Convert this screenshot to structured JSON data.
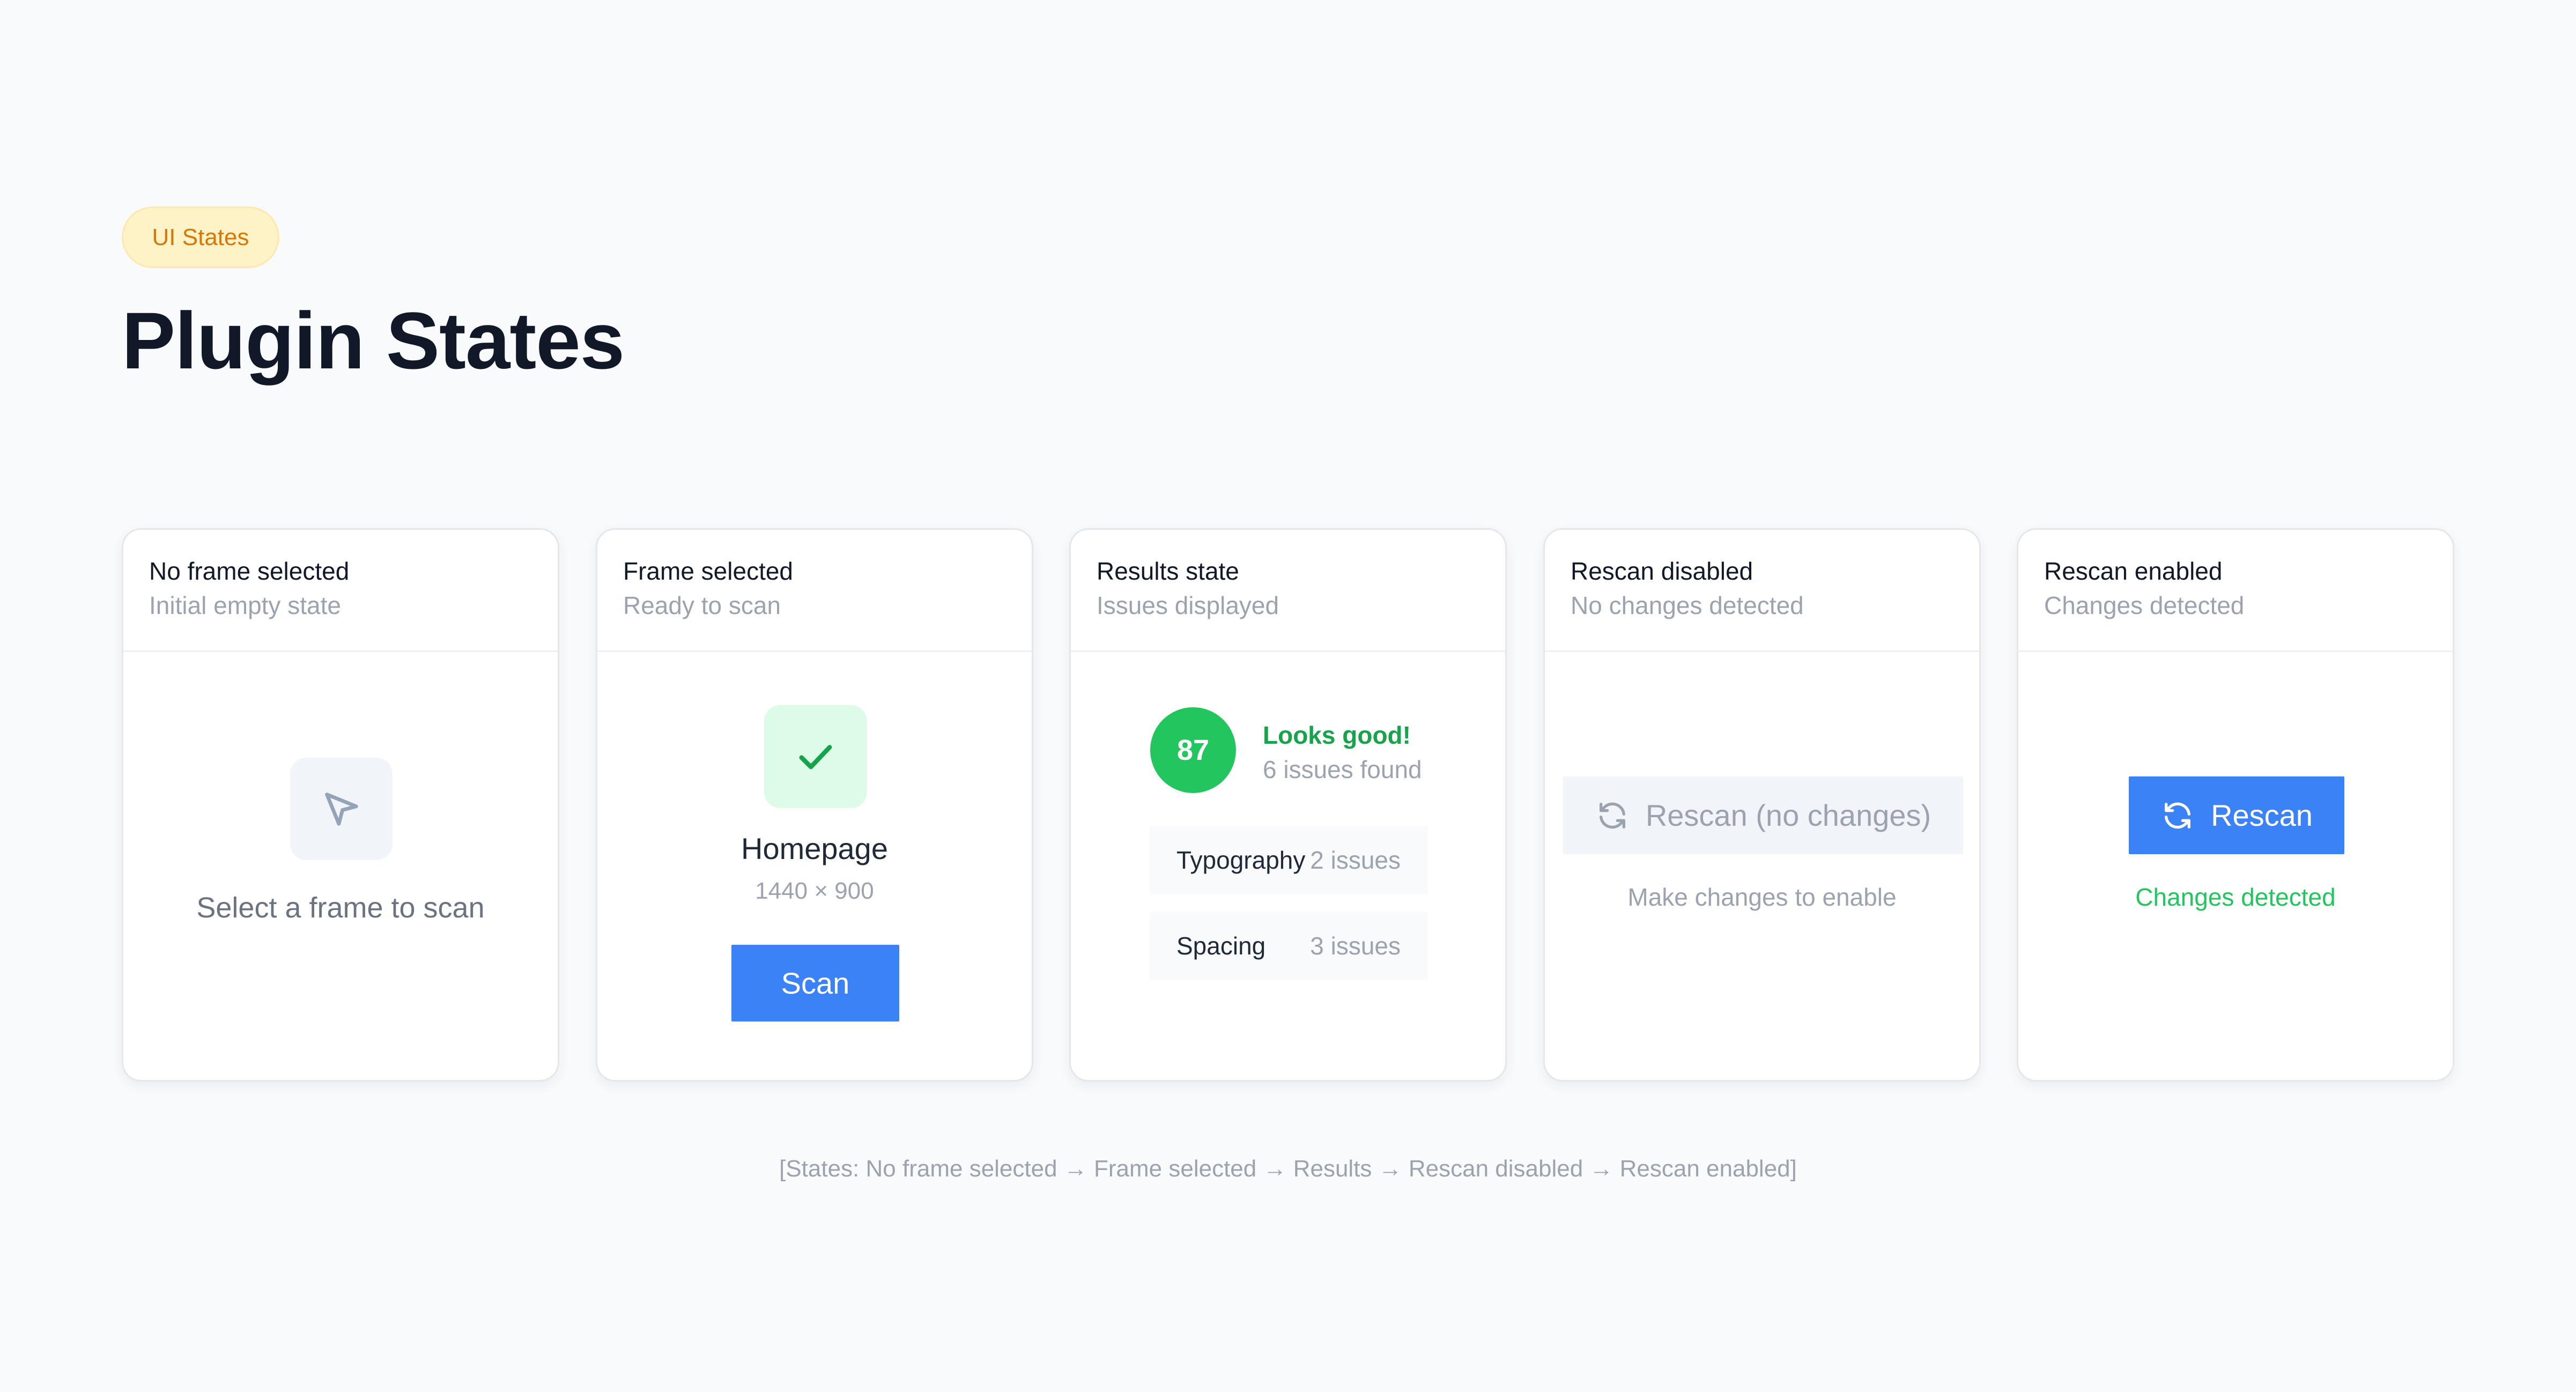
{
  "header": {
    "badge": "UI States",
    "title": "Plugin States"
  },
  "cards": [
    {
      "title": "No frame selected",
      "subtitle": "Initial empty state",
      "icon": "cursor-pointer-icon",
      "message": "Select a frame to scan"
    },
    {
      "title": "Frame selected",
      "subtitle": "Ready to scan",
      "icon": "checkmark-icon",
      "frame_name": "Homepage",
      "frame_size": "1440 × 900",
      "button": "Scan"
    },
    {
      "title": "Results state",
      "subtitle": "Issues displayed",
      "score": "87",
      "status": "Looks good!",
      "issues_found": "6 issues found",
      "issues": [
        {
          "label": "Typography",
          "count": "2 issues"
        },
        {
          "label": "Spacing",
          "count": "3 issues"
        }
      ]
    },
    {
      "title": "Rescan disabled",
      "subtitle": "No changes detected",
      "icon": "refresh-icon",
      "button": "Rescan (no changes)",
      "hint": "Make changes to enable"
    },
    {
      "title": "Rescan enabled",
      "subtitle": "Changes detected",
      "icon": "refresh-icon",
      "button": "Rescan",
      "hint": "Changes detected"
    }
  ],
  "footer": {
    "caption": "[States: No frame selected → Frame selected → Results → Rescan disabled → Rescan enabled]"
  },
  "colors": {
    "primary": "#3b82f6",
    "success": "#22c55e",
    "success_text": "#16a34a",
    "badge_bg": "#fef3c7",
    "badge_text": "#d97706",
    "muted": "#9ca3af"
  }
}
